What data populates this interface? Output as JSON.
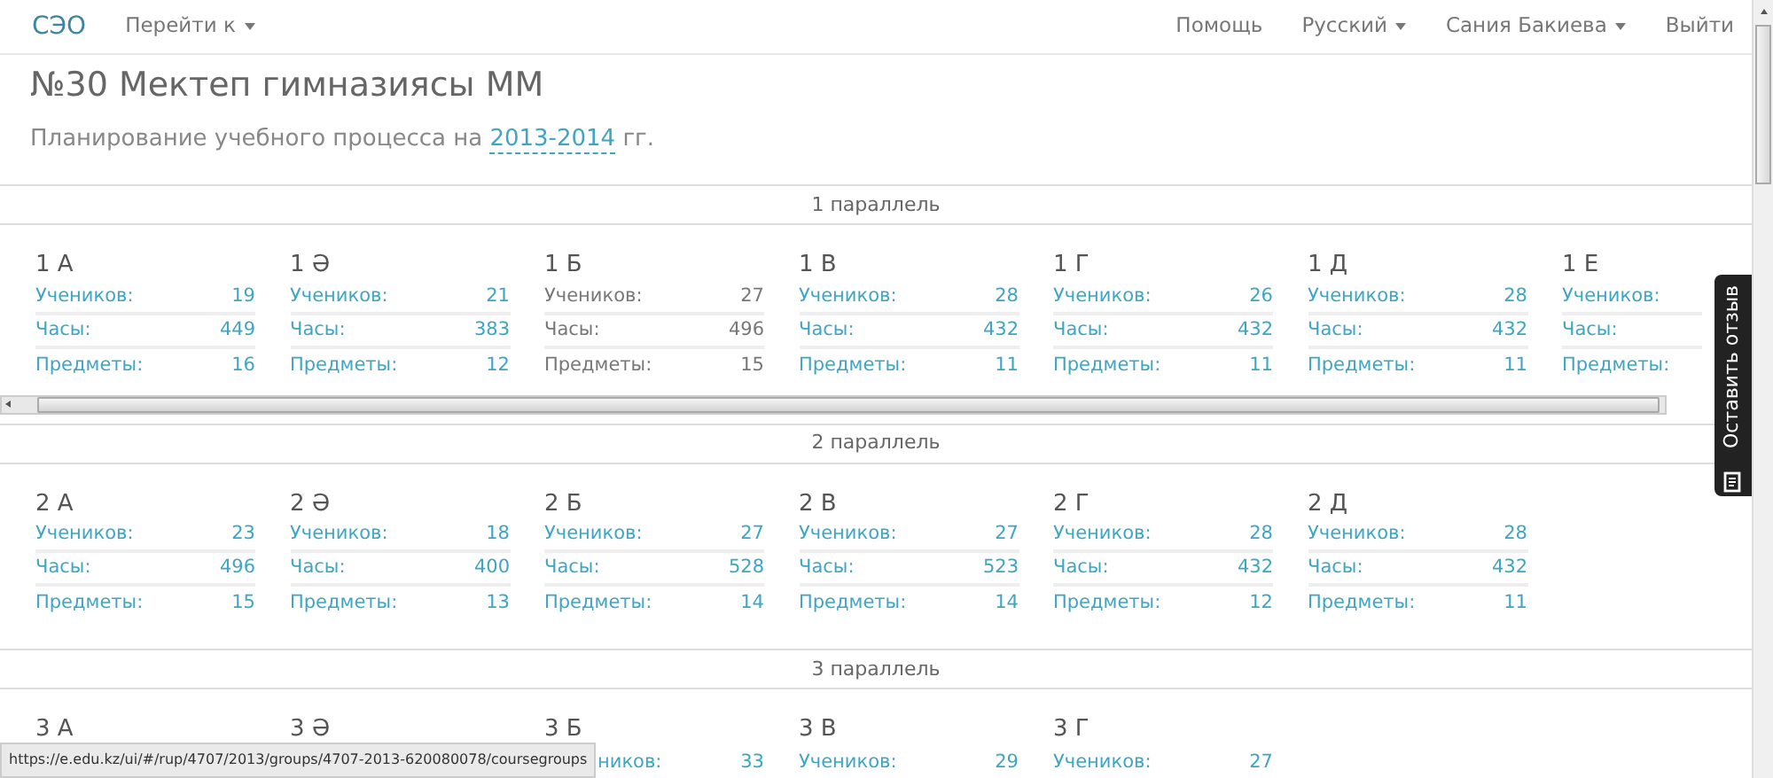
{
  "navbar": {
    "brand": "СЭО",
    "left_items": [
      {
        "label": "Перейти к",
        "dropdown": true
      }
    ],
    "right_items": [
      {
        "label": "Помощь",
        "dropdown": false
      },
      {
        "label": "Русский",
        "dropdown": true
      },
      {
        "label": "Сания Бакиева",
        "dropdown": true
      },
      {
        "label": "Выйти",
        "dropdown": false
      }
    ]
  },
  "header": {
    "title": "№30 Мектеп гимназиясы ММ",
    "subtitle_before": "Планирование учебного процесса на",
    "year_link": "2013-2014",
    "subtitle_after": "гг."
  },
  "parallels": [
    {
      "label": "1 параллель",
      "horizontal_scroll": true,
      "classes": [
        {
          "name": "1 А",
          "stats": [
            {
              "label": "Учеников:",
              "value": "19",
              "linked": true
            },
            {
              "label": "Часы:",
              "value": "449",
              "linked": true
            },
            {
              "label": "Предметы:",
              "value": "16",
              "linked": true
            }
          ]
        },
        {
          "name": "1 Ә",
          "stats": [
            {
              "label": "Учеников:",
              "value": "21",
              "linked": true
            },
            {
              "label": "Часы:",
              "value": "383",
              "linked": true
            },
            {
              "label": "Предметы:",
              "value": "12",
              "linked": true
            }
          ]
        },
        {
          "name": "1 Б",
          "stats": [
            {
              "label": "Учеников:",
              "value": "27",
              "linked": false
            },
            {
              "label": "Часы:",
              "value": "496",
              "linked": false
            },
            {
              "label": "Предметы:",
              "value": "15",
              "linked": false
            }
          ]
        },
        {
          "name": "1 В",
          "stats": [
            {
              "label": "Учеников:",
              "value": "28",
              "linked": true
            },
            {
              "label": "Часы:",
              "value": "432",
              "linked": true
            },
            {
              "label": "Предметы:",
              "value": "11",
              "linked": true
            }
          ]
        },
        {
          "name": "1 Г",
          "stats": [
            {
              "label": "Учеников:",
              "value": "26",
              "linked": true
            },
            {
              "label": "Часы:",
              "value": "432",
              "linked": true
            },
            {
              "label": "Предметы:",
              "value": "11",
              "linked": true
            }
          ]
        },
        {
          "name": "1 Д",
          "stats": [
            {
              "label": "Учеников:",
              "value": "28",
              "linked": true
            },
            {
              "label": "Часы:",
              "value": "432",
              "linked": true
            },
            {
              "label": "Предметы:",
              "value": "11",
              "linked": true
            }
          ]
        },
        {
          "name": "1 Е",
          "stats": [
            {
              "label": "Учеников:",
              "linked": true
            },
            {
              "label": "Часы:",
              "linked": true
            },
            {
              "label": "Предметы:",
              "linked": true
            }
          ]
        }
      ]
    },
    {
      "label": "2 параллель",
      "horizontal_scroll": false,
      "classes": [
        {
          "name": "2 А",
          "stats": [
            {
              "label": "Учеников:",
              "value": "23",
              "linked": true
            },
            {
              "label": "Часы:",
              "value": "496",
              "linked": true
            },
            {
              "label": "Предметы:",
              "value": "15",
              "linked": true
            }
          ]
        },
        {
          "name": "2 Ә",
          "stats": [
            {
              "label": "Учеников:",
              "value": "18",
              "linked": true
            },
            {
              "label": "Часы:",
              "value": "400",
              "linked": true
            },
            {
              "label": "Предметы:",
              "value": "13",
              "linked": true
            }
          ]
        },
        {
          "name": "2 Б",
          "stats": [
            {
              "label": "Учеников:",
              "value": "27",
              "linked": true
            },
            {
              "label": "Часы:",
              "value": "528",
              "linked": true
            },
            {
              "label": "Предметы:",
              "value": "14",
              "linked": true
            }
          ]
        },
        {
          "name": "2 В",
          "stats": [
            {
              "label": "Учеников:",
              "value": "27",
              "linked": true
            },
            {
              "label": "Часы:",
              "value": "523",
              "linked": true
            },
            {
              "label": "Предметы:",
              "value": "14",
              "linked": true
            }
          ]
        },
        {
          "name": "2 Г",
          "stats": [
            {
              "label": "Учеников:",
              "value": "28",
              "linked": true
            },
            {
              "label": "Часы:",
              "value": "432",
              "linked": true
            },
            {
              "label": "Предметы:",
              "value": "12",
              "linked": true
            }
          ]
        },
        {
          "name": "2 Д",
          "stats": [
            {
              "label": "Учеников:",
              "value": "28",
              "linked": true
            },
            {
              "label": "Часы:",
              "value": "432",
              "linked": true
            },
            {
              "label": "Предметы:",
              "value": "11",
              "linked": true
            }
          ]
        }
      ]
    },
    {
      "label": "3 параллель",
      "horizontal_scroll": false,
      "classes": [
        {
          "name": "3 А"
        },
        {
          "name": "3 Ә"
        },
        {
          "name": "3 Б",
          "stats": [
            {
              "label": "ников:",
              "value": "33",
              "linked": true
            }
          ]
        },
        {
          "name": "3 В",
          "stats": [
            {
              "label": "Учеников:",
              "value": "29",
              "linked": true
            }
          ]
        },
        {
          "name": "3 Г",
          "stats": [
            {
              "label": "Учеников:",
              "value": "27",
              "linked": true
            }
          ]
        }
      ]
    }
  ],
  "feedback_tab": {
    "label": "Оставить отзыв"
  },
  "status_url": "https://e.edu.kz/ui/#/rup/4707/2013/groups/4707-2013-620080078/coursegroups"
}
